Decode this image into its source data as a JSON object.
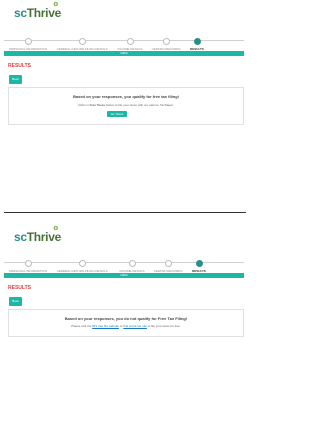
{
  "top": {
    "logo": {
      "sc": "sc",
      "thrive": "Thrive"
    },
    "steps": [
      {
        "label": "PERSONAL INFORMATION",
        "active": false
      },
      {
        "label": "FEDERAL RETURN FILING DETAILS",
        "active": false
      },
      {
        "label": "INCOME DETAILS",
        "active": false
      },
      {
        "label": "CERTAIN RECORDS",
        "active": false
      },
      {
        "label": "RESULTS",
        "active": true
      }
    ],
    "progress_label": "100%",
    "results_title": "RESULTS",
    "back_label": "Back",
    "heading": "Based on your responses, you qualify for free tax filing!",
    "sub_prefix": "Click on ",
    "sub_bold": "Free Taxes",
    "sub_suffix": " button to file your taxes with our partner, TaxSlayer.",
    "button_label": "Go Taxes"
  },
  "bottom": {
    "logo": {
      "sc": "sc",
      "thrive": "Thrive"
    },
    "steps": [
      {
        "label": "PERSONAL INFORMATION",
        "active": false
      },
      {
        "label": "FEDERAL RETURN FILING DETAILS",
        "active": false
      },
      {
        "label": "INCOME DETAILS",
        "active": false
      },
      {
        "label": "CERTAIN RECORDS",
        "active": false
      },
      {
        "label": "RESULTS",
        "active": true
      }
    ],
    "progress_label": "100%",
    "results_title": "RESULTS",
    "back_label": "Back",
    "heading": "Based on your responses, you do not qualify for Free Tax Filing!",
    "sub_prefix": "Please visit the ",
    "sub_link1": "IRS free file website",
    "sub_middle": " or ",
    "sub_link2": "find a free tax site",
    "sub_suffix": " to file your taxes for free.",
    "button_label": ""
  },
  "colors": {
    "teal": "#1cb7a5",
    "results_red": "#d84343",
    "logo_teal": "#2a8f86",
    "logo_green": "#4a6f35"
  }
}
